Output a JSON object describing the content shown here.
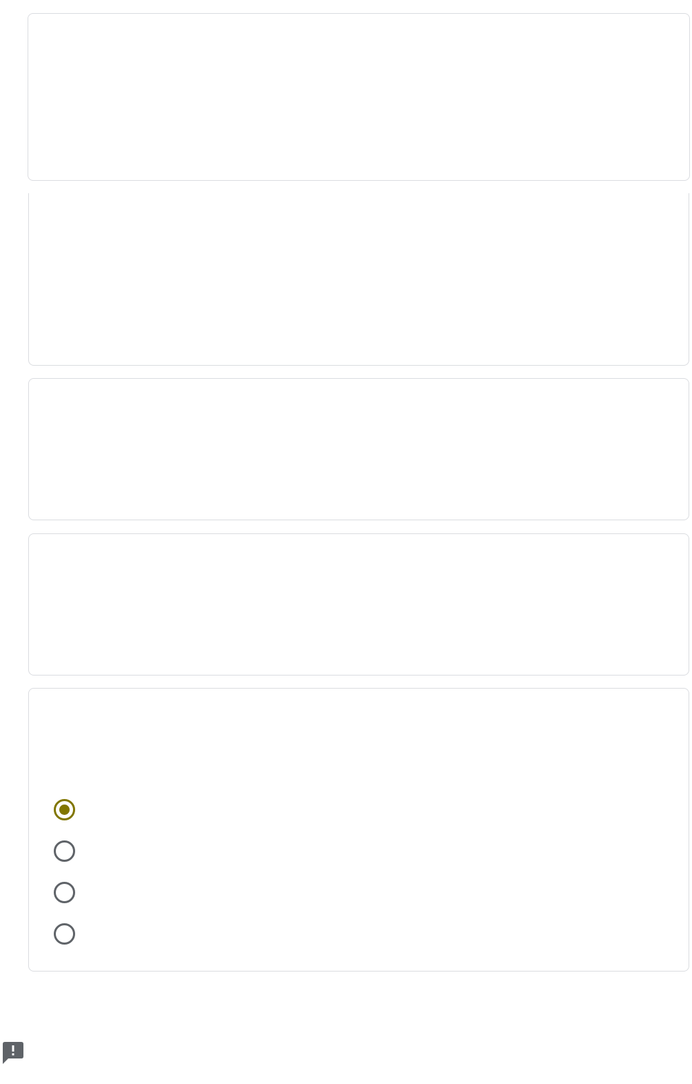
{
  "theme": {
    "accent_color": "#817600",
    "unselected_radio_color": "#5f6368",
    "card_border_color": "#dadce0",
    "report_icon_color": "#5f6368"
  },
  "form": {
    "cards": [
      {
        "content": ""
      },
      {
        "content": ""
      },
      {
        "content": ""
      },
      {
        "content": ""
      },
      {
        "question": "",
        "options": [
          {
            "label": "",
            "selected": true
          },
          {
            "label": "",
            "selected": false
          },
          {
            "label": "",
            "selected": false
          },
          {
            "label": "",
            "selected": false
          }
        ]
      }
    ]
  },
  "footer": {
    "report_icon": "report-issue-icon"
  }
}
